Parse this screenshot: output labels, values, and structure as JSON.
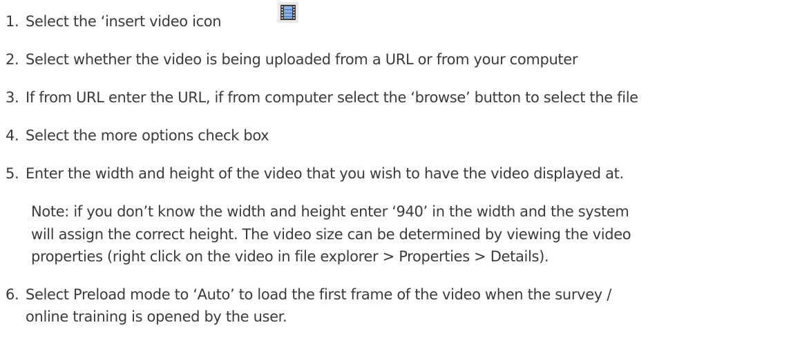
{
  "steps": [
    {
      "number": "1.",
      "text": "Select the ‘insert video icon",
      "icon": "film-strip-icon"
    },
    {
      "number": "2.",
      "text": "Select whether the video is being uploaded from a URL or from your computer"
    },
    {
      "number": "3.",
      "text": "If from URL enter the URL, if from computer select the ‘browse’ button to select the file"
    },
    {
      "number": "4.",
      "text": "Select the more options check box"
    },
    {
      "number": "5.",
      "text": "Enter the width and height of the video that you wish to have the video displayed at."
    },
    {
      "number": "6.",
      "lines": [
        "Select Preload mode to ‘Auto’ to load the first frame of the video when the survey /",
        "online training is opened by the user."
      ]
    }
  ],
  "note": {
    "lines": [
      "Note: if you don’t know the width and height enter ‘940’ in the width and the system",
      "will assign the correct height.   The video size can be determined by viewing the video",
      "properties (right click on the video in file explorer > Properties > Details)."
    ]
  }
}
